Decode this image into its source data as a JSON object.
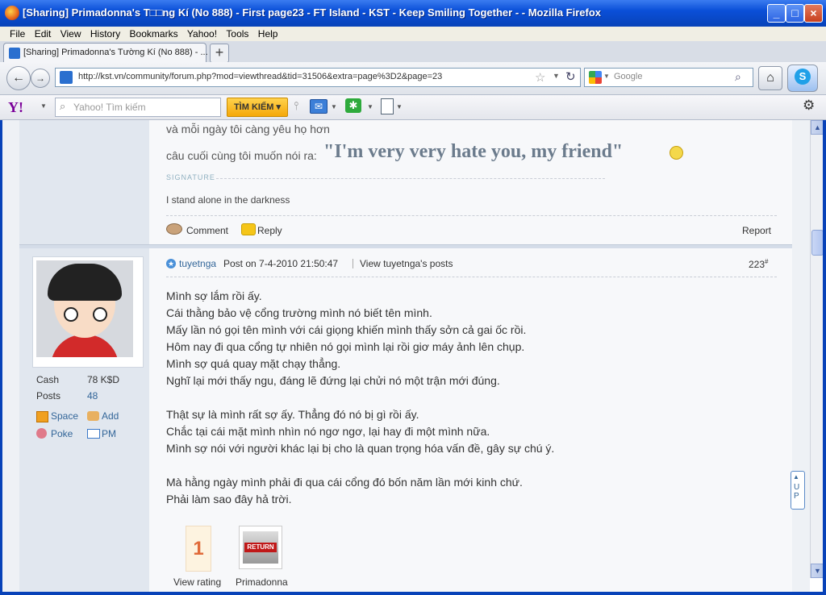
{
  "window": {
    "title": "[Sharing] Primadonna's T□□ng Kí (No 888) - First page23 - FT Island - KST - Keep Smiling Together - - Mozilla Firefox"
  },
  "menu": [
    "File",
    "Edit",
    "View",
    "History",
    "Bookmarks",
    "Yahoo!",
    "Tools",
    "Help"
  ],
  "tab": {
    "label": "[Sharing] Primadonna's Tường Kí (No 888) - ..."
  },
  "nav": {
    "url": "http://kst.vn/community/forum.php?mod=viewthread&tid=31506&extra=page%3D2&page=23",
    "search_placeholder": "Google"
  },
  "yahoo": {
    "logo": "Y!",
    "search_placeholder": "Yahoo! Tìm kiếm",
    "search_button": "TÌM KIẾM"
  },
  "prev_post": {
    "line1": "và mỗi ngày tôi càng yêu họ hơn",
    "line2_prefix": "câu cuối cùng tôi muốn nói ra:",
    "line2_quote": "\"I'm very very hate you, my friend\"",
    "signature_label": "SIGNATURE",
    "signature_text": "I stand alone in the darkness",
    "comment": "Comment",
    "reply": "Reply",
    "report": "Report"
  },
  "post": {
    "author": "tuyetnga",
    "posted_on": "Post on 7-4-2010 21:50:47",
    "view_posts": "View tuyetnga's posts",
    "number": "223",
    "number_suffix": "#",
    "cash_label": "Cash",
    "cash_value": "78 K$D",
    "posts_label": "Posts",
    "posts_value": "48",
    "space": "Space",
    "add": "Add",
    "poke": "Poke",
    "pm": "PM",
    "lines": [
      "Mình sợ lắm rồi ấy.",
      "Cái thằng bảo vệ cổng trường mình nó biết tên mình.",
      "Mấy lần nó gọi tên mình với cái giọng khiến mình thấy sởn cả gai ốc rồi.",
      "Hôm nay đi qua cổng tự nhiên nó gọi mình lại rồi giơ máy ảnh lên chụp.",
      "Mình sợ quá quay mặt chạy thẳng.",
      "Nghĩ lại mới thấy ngu, đáng lẽ đứng lại chửi nó một trận mới đúng.",
      "",
      "Thật sự là mình rất sợ ấy. Thẳng đó nó bị gì rồi ấy.",
      "Chắc tại cái mặt mình nhìn nó ngơ ngơ, lại hay đi một mình nữa.",
      "Mình sợ nói với người khác lại bị cho là quan trọng hóa vấn đề, gây sự chú ý.",
      "",
      "Mà hằng ngày mình phải đi qua cái cổng đó bốn năm lần mới kinh chứ.",
      "Phải làm sao đây hả trời."
    ],
    "rating_value": "1",
    "rating_label": "View rating",
    "badge_text": "RETURN",
    "badge_label": "Primadonna"
  },
  "side_tab": "UP"
}
